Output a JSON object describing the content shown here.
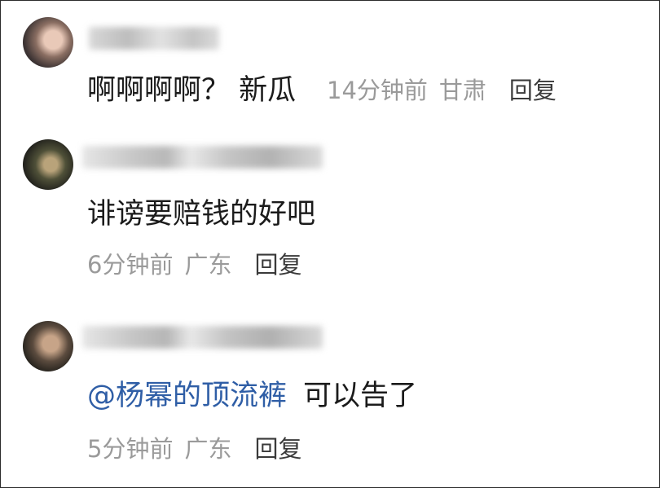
{
  "comments": [
    {
      "user": "",
      "text": "啊啊啊啊？ 新瓜",
      "time": "14分钟前",
      "location": "甘肃",
      "reply_label": "回复"
    },
    {
      "user": "",
      "text": "诽谤要赔钱的好吧",
      "time": "6分钟前",
      "location": "广东",
      "reply_label": "回复"
    },
    {
      "user": "",
      "mention": "@杨幂的顶流裤",
      "text": "可以告了",
      "time": "5分钟前",
      "location": "广东",
      "reply_label": "回复"
    }
  ],
  "colors": {
    "text": "#1b1b1b",
    "meta": "#9a9a9a",
    "mention": "#2f5ea6"
  }
}
